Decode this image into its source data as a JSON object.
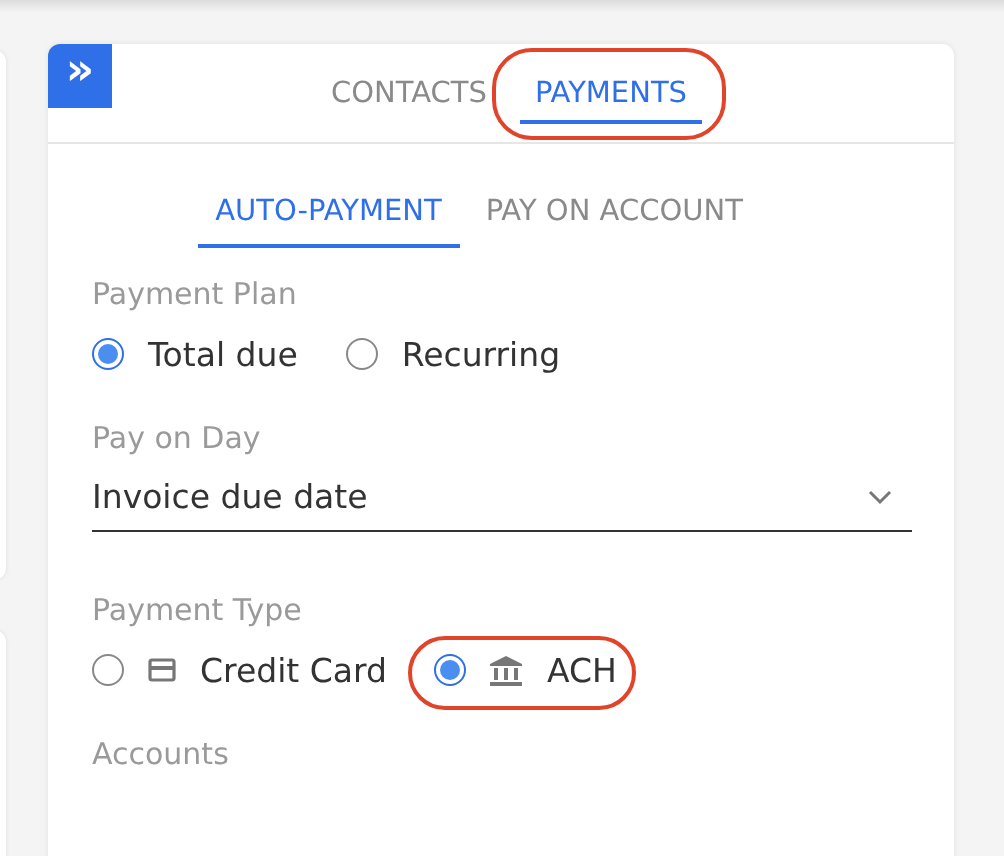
{
  "expand_button": {
    "label": "»"
  },
  "tabs": [
    {
      "label": "CONTACTS",
      "selected": false,
      "highlighted": false
    },
    {
      "label": "PAYMENTS",
      "selected": true,
      "highlighted": true
    }
  ],
  "subtabs": [
    {
      "label": "AUTO-PAYMENT",
      "selected": true
    },
    {
      "label": "PAY ON ACCOUNT",
      "selected": false
    }
  ],
  "payment_plan": {
    "label": "Payment Plan",
    "options": [
      {
        "label": "Total due",
        "selected": true
      },
      {
        "label": "Recurring",
        "selected": false
      }
    ]
  },
  "pay_on_day": {
    "label": "Pay on Day",
    "value": "Invoice due date"
  },
  "payment_type": {
    "label": "Payment Type",
    "options": [
      {
        "label": "Credit Card",
        "kind": "card",
        "selected": false,
        "highlighted": false
      },
      {
        "label": "ACH",
        "kind": "bank",
        "selected": true,
        "highlighted": true
      }
    ]
  },
  "accounts": {
    "label": "Accounts"
  }
}
